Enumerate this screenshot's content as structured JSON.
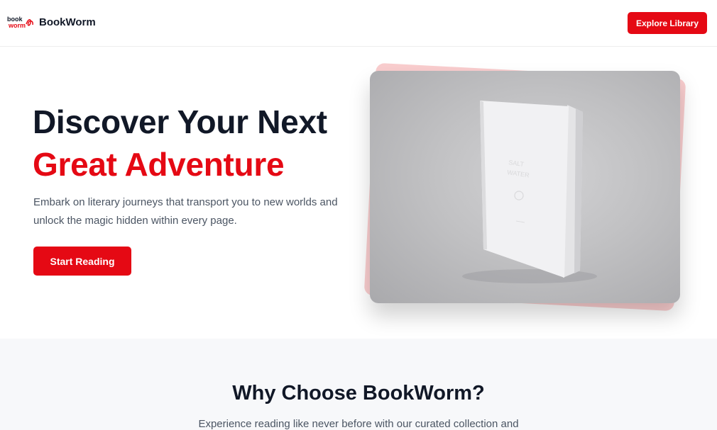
{
  "header": {
    "logo_text_top": "book",
    "logo_text_bottom": "worm",
    "brand": "BookWorm",
    "explore_label": "Explore Library"
  },
  "hero": {
    "title_line1": "Discover Your Next",
    "title_line2": "Great Adventure",
    "description": "Embark on literary journeys that transport you to new worlds and unlock the magic hidden within every page.",
    "cta_label": "Start Reading",
    "image": "white-book-photo"
  },
  "why": {
    "title": "Why Choose BookWorm?",
    "description": "Experience reading like never before with our curated collection and"
  },
  "colors": {
    "accent": "#e50914",
    "heading": "#111827",
    "muted": "#4b5563",
    "section_bg": "#f7f8fa"
  }
}
